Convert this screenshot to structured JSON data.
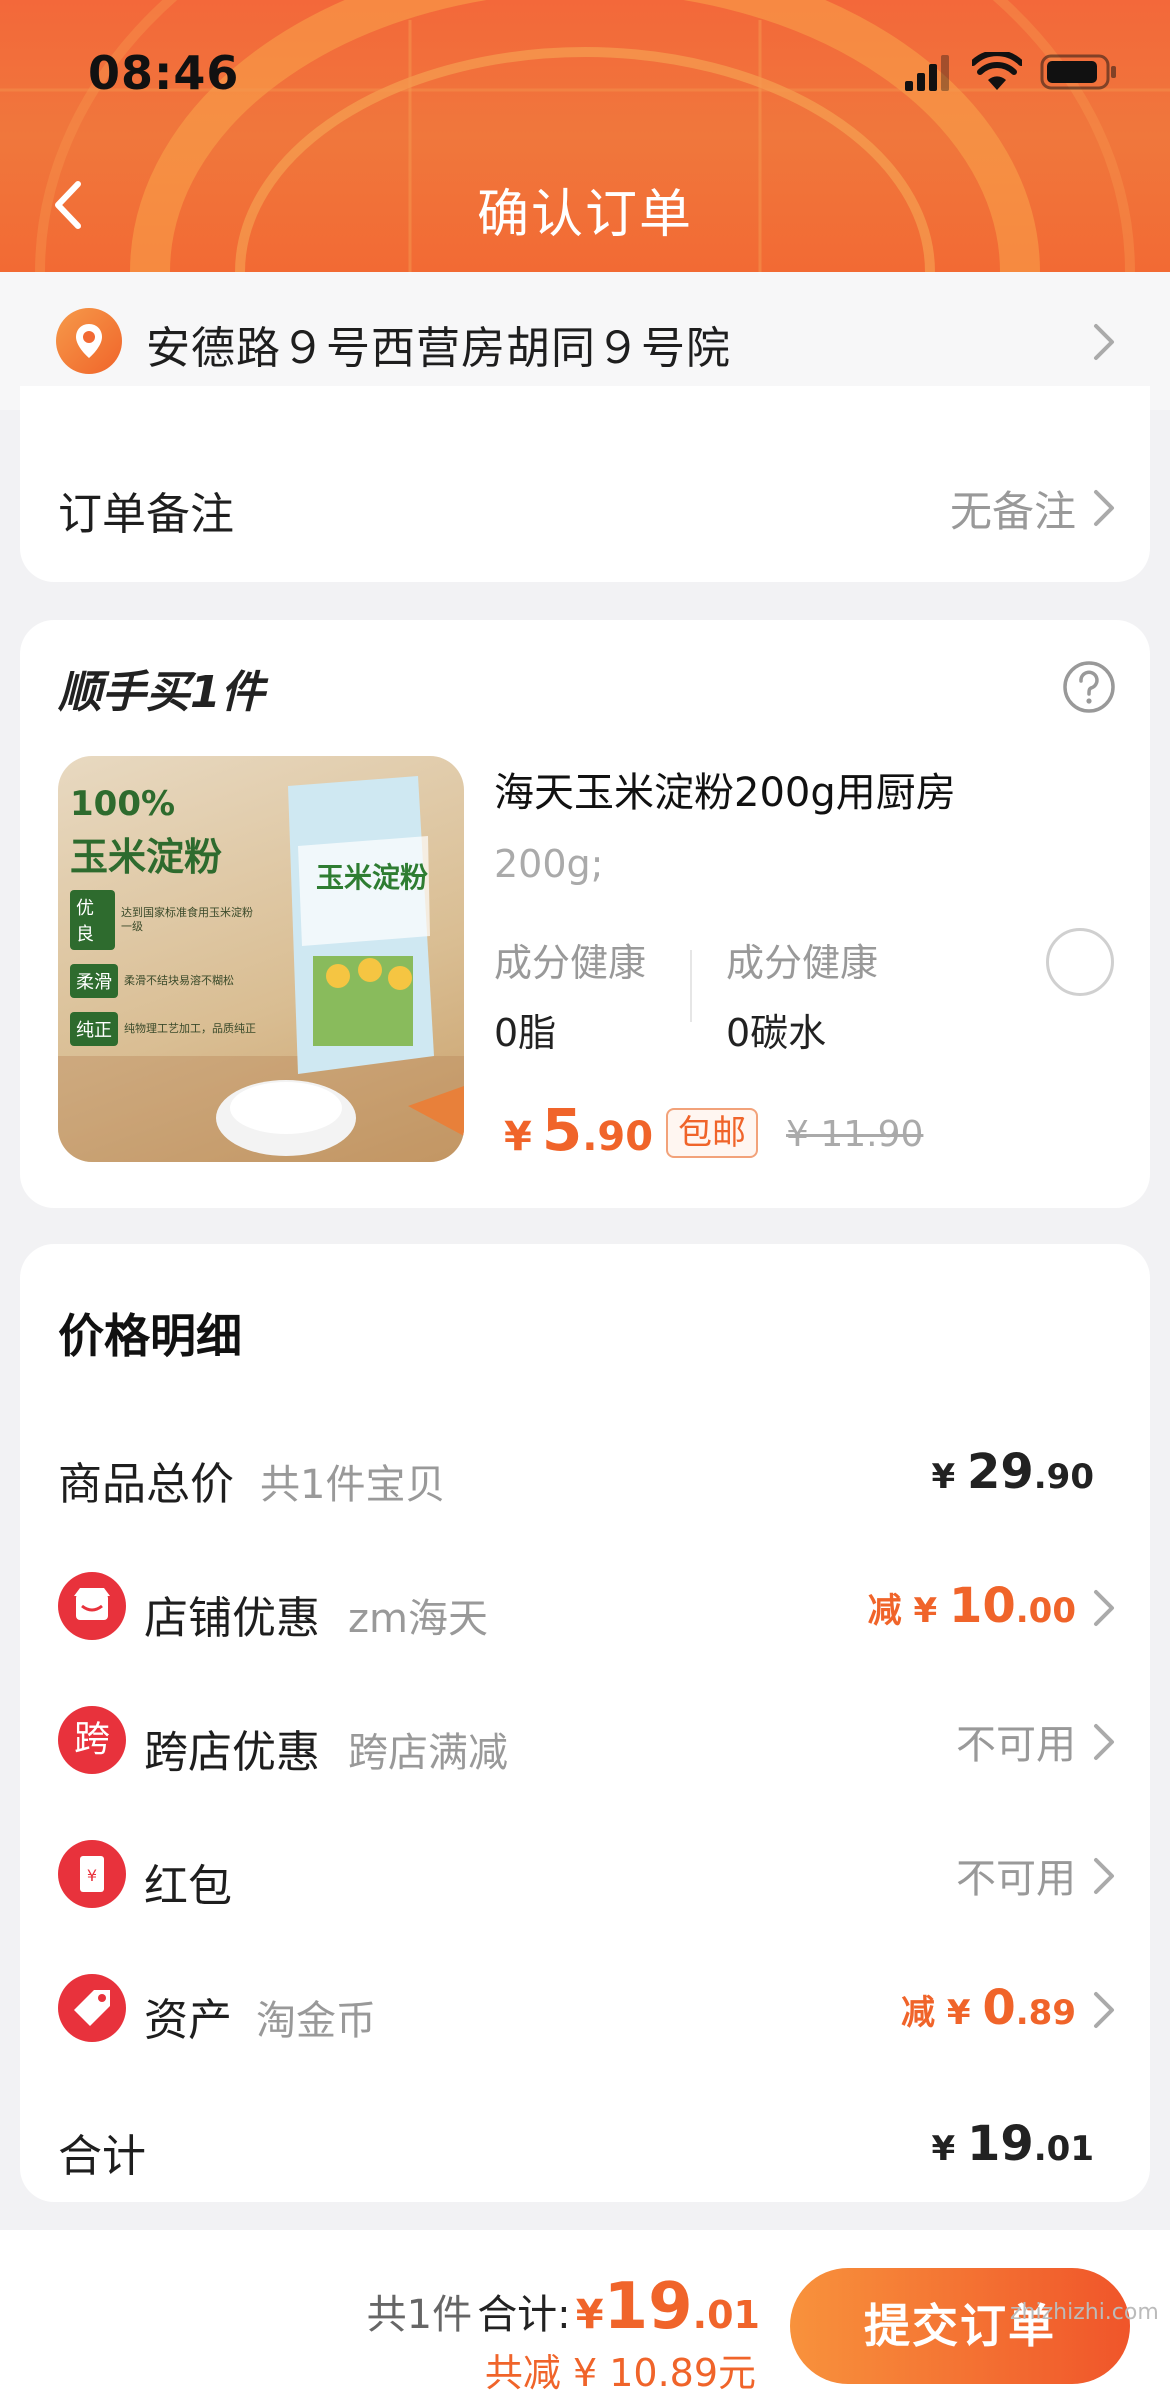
{
  "status_bar": {
    "time": "08:46"
  },
  "header": {
    "title": "确认订单"
  },
  "address": {
    "text": "安德路９号西营房胡同９号院"
  },
  "note": {
    "label": "订单备注",
    "value": "无备注"
  },
  "add_on": {
    "title": "顺手买1件",
    "product": {
      "name": "海天玉米淀粉200g用厨房",
      "spec": "200g;",
      "attr1_label": "成分健康",
      "attr1_value": "0脂",
      "attr2_label": "成分健康",
      "attr2_value": "0碳水",
      "price_symbol": "¥",
      "price_int": "5",
      "price_dec": ".90",
      "shipping_tag": "包邮",
      "original_price": "¥ 11.90",
      "image_text": {
        "headline1": "100%",
        "headline2": "玉米淀粉",
        "badge1": "优良",
        "badge1_note": "达到国家标准食用玉米淀粉一级",
        "badge2": "柔滑",
        "badge2_note": "柔滑不结块易溶不糊松",
        "badge3": "纯正",
        "badge3_note": "纯物理工艺加工，品质纯正",
        "pack_text": "玉米淀粉"
      }
    }
  },
  "price_detail": {
    "title": "价格明细",
    "goods": {
      "label": "商品总价",
      "sub": "共1件宝贝",
      "sym": "¥ ",
      "int": "29",
      "dec": ".90"
    },
    "shop": {
      "label": "店铺优惠",
      "sub": "zm海天",
      "prefix": "减",
      "sym": " ¥ ",
      "int": "10",
      "dec": ".00"
    },
    "cross": {
      "label": "跨店优惠",
      "sub": "跨店满减",
      "value": "不可用",
      "icon_char": "跨"
    },
    "redpack": {
      "label": "红包",
      "value": "不可用",
      "icon_char": "¥"
    },
    "assets": {
      "label": "资产",
      "sub": "淘金币",
      "prefix": "减",
      "sym": " ¥ ",
      "int": "0",
      "dec": ".89"
    },
    "total": {
      "label": "合计",
      "sym": "¥ ",
      "int": "19",
      "dec": ".01"
    }
  },
  "bottom_bar": {
    "count": "共1件",
    "label": "合计:",
    "sym": "¥",
    "int": "19",
    "dec": ".01",
    "saved": "共减 ¥ 10.89元",
    "submit": "提交订单"
  },
  "watermark": "zhizhizhi.com",
  "colors": {
    "accent": "#f0642a",
    "header": "#f26a34",
    "red_icon": "#e8323c"
  }
}
